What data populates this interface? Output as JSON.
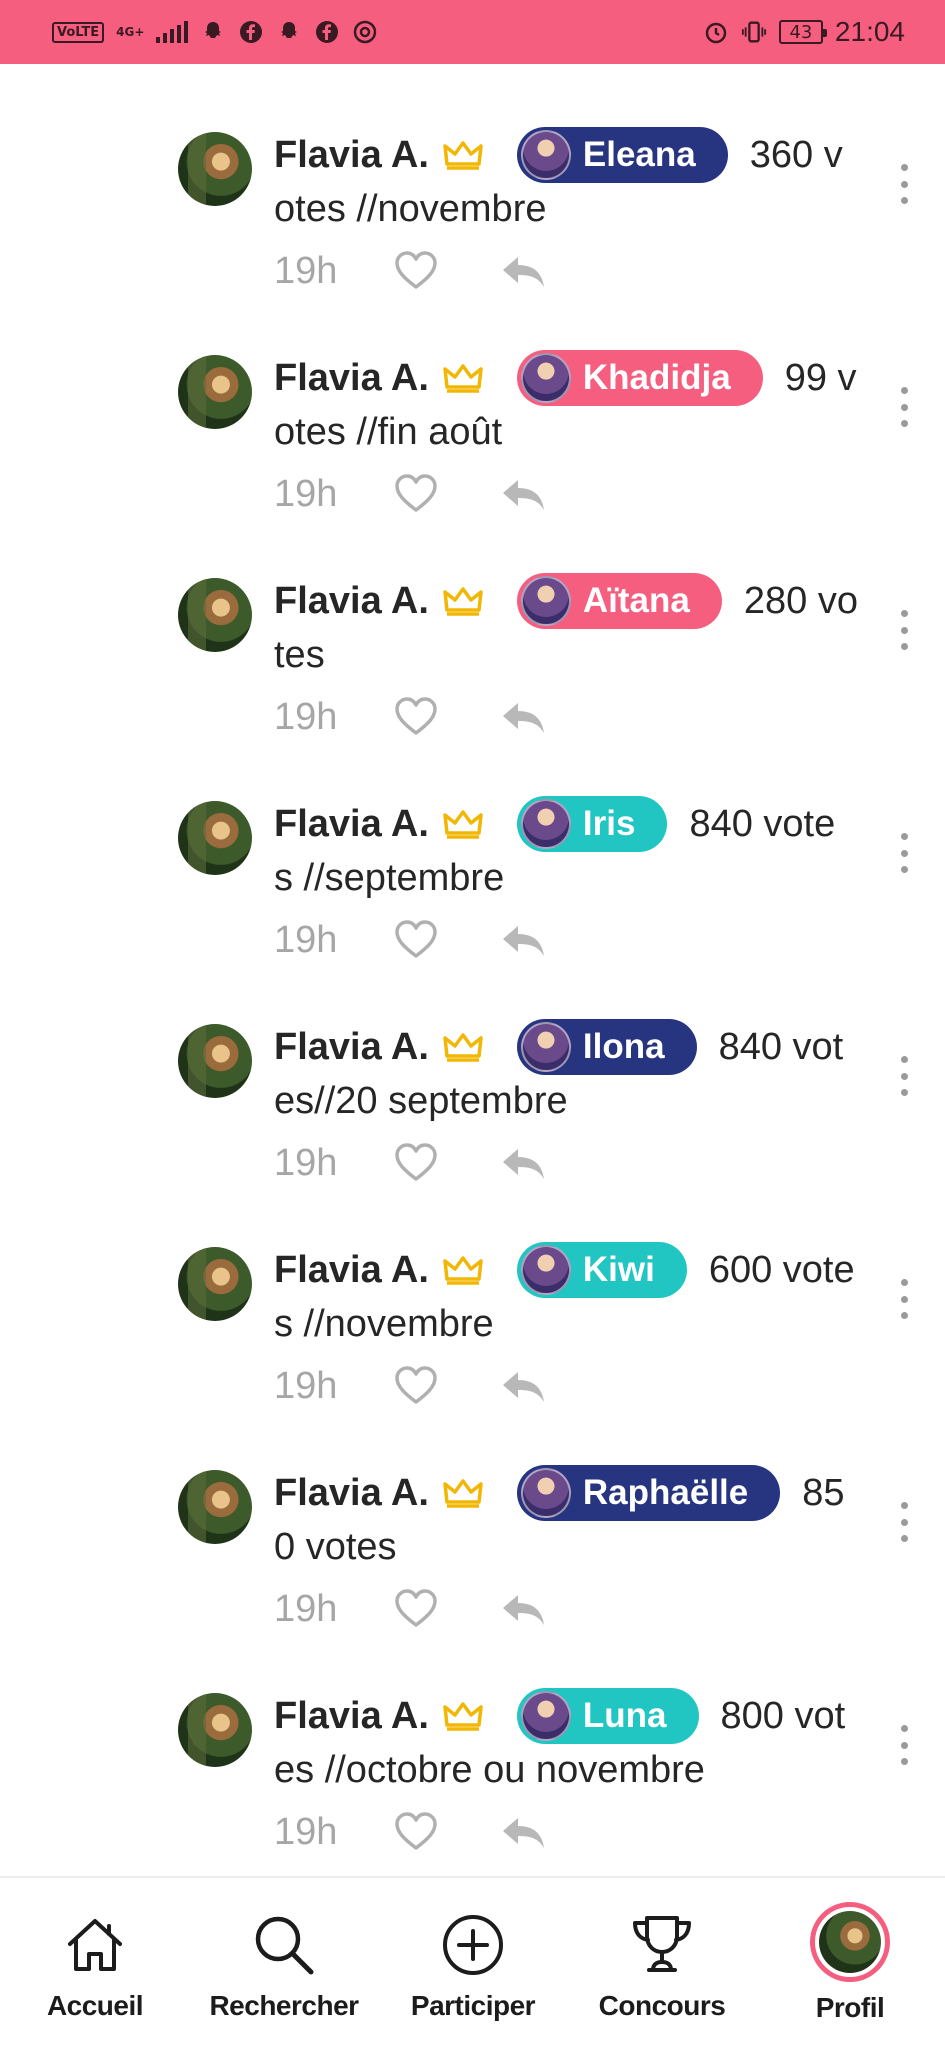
{
  "status_bar": {
    "volte": "VoLTE",
    "network": "4G+",
    "battery": "43",
    "time": "21:04",
    "icons": [
      "signal-icon",
      "snapchat-icon",
      "facebook-icon",
      "snapchat-icon",
      "facebook-icon",
      "chrome-icon",
      "alarm-icon",
      "vibrate-icon",
      "battery-icon"
    ]
  },
  "comments": [
    {
      "user": "Flavia A.",
      "mention": "Eleana",
      "chip_color": "#27347f",
      "text_line1": "360 v",
      "text_line2": "otes //novembre",
      "time": "19h"
    },
    {
      "user": "Flavia A.",
      "mention": "Khadidja",
      "chip_color": "#f65e7f",
      "text_line1": "99 v",
      "text_line2": "otes //fin août",
      "time": "19h"
    },
    {
      "user": "Flavia A.",
      "mention": "Aïtana",
      "chip_color": "#f65e7f",
      "text_line1": "280 vo",
      "text_line2": "tes",
      "time": "19h"
    },
    {
      "user": "Flavia A.",
      "mention": "Iris",
      "chip_color": "#21c6c2",
      "text_line1": "840 vote",
      "text_line2": "s //septembre",
      "time": "19h"
    },
    {
      "user": "Flavia A.",
      "mention": "Ilona",
      "chip_color": "#27347f",
      "text_line1": "840 vot",
      "text_line2": "es//20 septembre",
      "time": "19h"
    },
    {
      "user": "Flavia A.",
      "mention": "Kiwi",
      "chip_color": "#21c6c2",
      "text_line1": "600 vote",
      "text_line2": "s //novembre",
      "time": "19h"
    },
    {
      "user": "Flavia A.",
      "mention": "Raphaëlle",
      "chip_color": "#27347f",
      "text_line1": "85",
      "text_line2": "0 votes",
      "time": "19h"
    },
    {
      "user": "Flavia A.",
      "mention": "Luna",
      "chip_color": "#21c6c2",
      "text_line1": "800 vot",
      "text_line2": "es //octobre ou novembre",
      "time": "19h"
    }
  ],
  "nav": {
    "home": "Accueil",
    "search": "Rechercher",
    "participate": "Participer",
    "contests": "Concours",
    "profile": "Profil"
  },
  "colors": {
    "accent": "#f65e7f",
    "navy": "#27347f",
    "teal": "#21c6c2",
    "crown": "#f2b705"
  }
}
